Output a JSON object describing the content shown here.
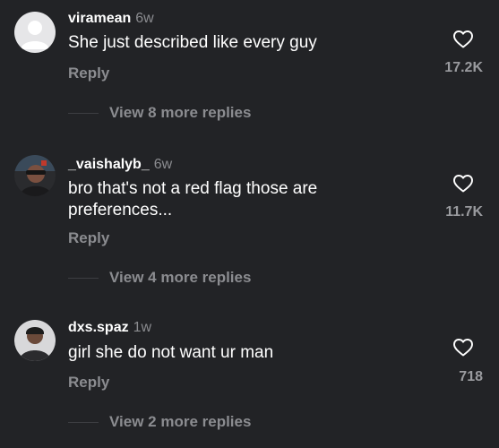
{
  "comments": [
    {
      "username": "viramean",
      "time": "6w",
      "text": "She just described like every guy",
      "reply_label": "Reply",
      "like_count": "17.2K",
      "view_more": "View 8 more replies",
      "avatar": "default-avatar"
    },
    {
      "username": "_vaishalyb_",
      "time": "6w",
      "text": "bro that's not a red flag those are preferences...",
      "reply_label": "Reply",
      "like_count": "11.7K",
      "view_more": "View 4 more replies",
      "avatar": "photo-avatar"
    },
    {
      "username": "dxs.spaz",
      "time": "1w",
      "text": "girl she do not want ur man",
      "reply_label": "Reply",
      "like_count": "718",
      "view_more": "View 2 more replies",
      "avatar": "photo-avatar"
    }
  ],
  "icons": {
    "like": "heart-outline-icon"
  },
  "colors": {
    "background": "#222326",
    "primary_text": "#ffffff",
    "secondary_text": "#8b8c90"
  }
}
